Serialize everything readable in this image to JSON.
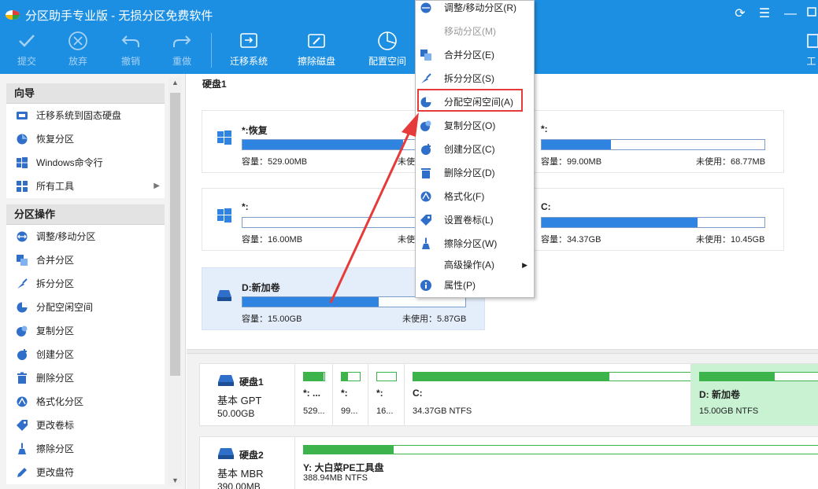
{
  "app": {
    "title": "分区助手专业版 - 无损分区免费软件"
  },
  "window_controls": {
    "refresh": "⟳",
    "menu": "☰",
    "minimize": "—"
  },
  "toolbar": {
    "commit": "提交",
    "discard": "放弃",
    "undo": "撤销",
    "redo": "重做",
    "migrate": "迁移系统",
    "wipe": "擦除磁盘",
    "allocate": "配置空间",
    "edge_label": "工"
  },
  "sidebar": {
    "wizard_title": "向导",
    "wizard_items": [
      "迁移系统到固态硬盘",
      "恢复分区",
      "Windows命令行",
      "所有工具"
    ],
    "ops_title": "分区操作",
    "ops_items": [
      "调整/移动分区",
      "合并分区",
      "拆分分区",
      "分配空闲空间",
      "复制分区",
      "创建分区",
      "删除分区",
      "格式化分区",
      "更改卷标",
      "擦除分区",
      "更改盘符"
    ]
  },
  "disk1": {
    "title": "硬盘1",
    "partitions": [
      {
        "name": "*:恢复",
        "capacity": "容量：529.00MB",
        "free": "未使",
        "used_fraction": 0.72
      },
      {
        "name": "*:",
        "capacity": "容量：99.00MB",
        "free": "未使用：68.77MB",
        "used_fraction": 0.31
      },
      {
        "name": "*:",
        "capacity": "容量：16.00MB",
        "free": "未使",
        "used_fraction": 0.0
      },
      {
        "name": "C:",
        "capacity": "容量：34.37GB",
        "free": "未使用：10.45GB",
        "used_fraction": 0.7
      },
      {
        "name": "D:新加卷",
        "capacity": "容量：15.00GB",
        "free": "未使用：5.87GB",
        "used_fraction": 0.61
      }
    ]
  },
  "diskmap": {
    "disk1": {
      "name": "硬盘1",
      "type": "基本 GPT",
      "size": "50.00GB",
      "blocks": [
        {
          "name": "*: ...",
          "size": "529...",
          "used_fraction": 0.95
        },
        {
          "name": "*:",
          "size": "99...",
          "used_fraction": 0.35
        },
        {
          "name": "*:",
          "size": "16...",
          "used_fraction": 0.0
        },
        {
          "name": "C:",
          "size": "34.37GB NTFS",
          "used_fraction": 0.7
        },
        {
          "name": "D: 新加卷",
          "size": "15.00GB NTFS",
          "used_fraction": 0.6
        }
      ]
    },
    "disk2": {
      "name": "硬盘2",
      "type": "基本 MBR",
      "size": "390.00MB",
      "blocks": [
        {
          "name": "Y: 大白菜PE工具盘",
          "size": "388.94MB NTFS",
          "used_fraction": 0.17
        }
      ]
    }
  },
  "context_menu": {
    "items": [
      {
        "label": "调整/移动分区(R)",
        "enabled": true
      },
      {
        "label": "移动分区(M)",
        "enabled": false
      },
      {
        "label": "合并分区(E)",
        "enabled": true
      },
      {
        "label": "拆分分区(S)",
        "enabled": true
      },
      {
        "label": "分配空闲空间(A)",
        "enabled": true,
        "highlighted": true
      },
      {
        "label": "复制分区(O)",
        "enabled": true
      },
      {
        "label": "创建分区(C)",
        "enabled": true
      },
      {
        "label": "删除分区(D)",
        "enabled": true
      },
      {
        "label": "格式化(F)",
        "enabled": true
      },
      {
        "label": "设置卷标(L)",
        "enabled": true
      },
      {
        "label": "擦除分区(W)",
        "enabled": true
      },
      {
        "label": "高级操作(A)",
        "enabled": true,
        "submenu": true
      },
      {
        "label": "属性(P)",
        "enabled": true
      }
    ]
  },
  "colors": {
    "accent": "#1d8fe3",
    "bar_blue": "#2f84e2",
    "bar_green": "#3cb44b",
    "highlight_red": "#e53b3b"
  }
}
